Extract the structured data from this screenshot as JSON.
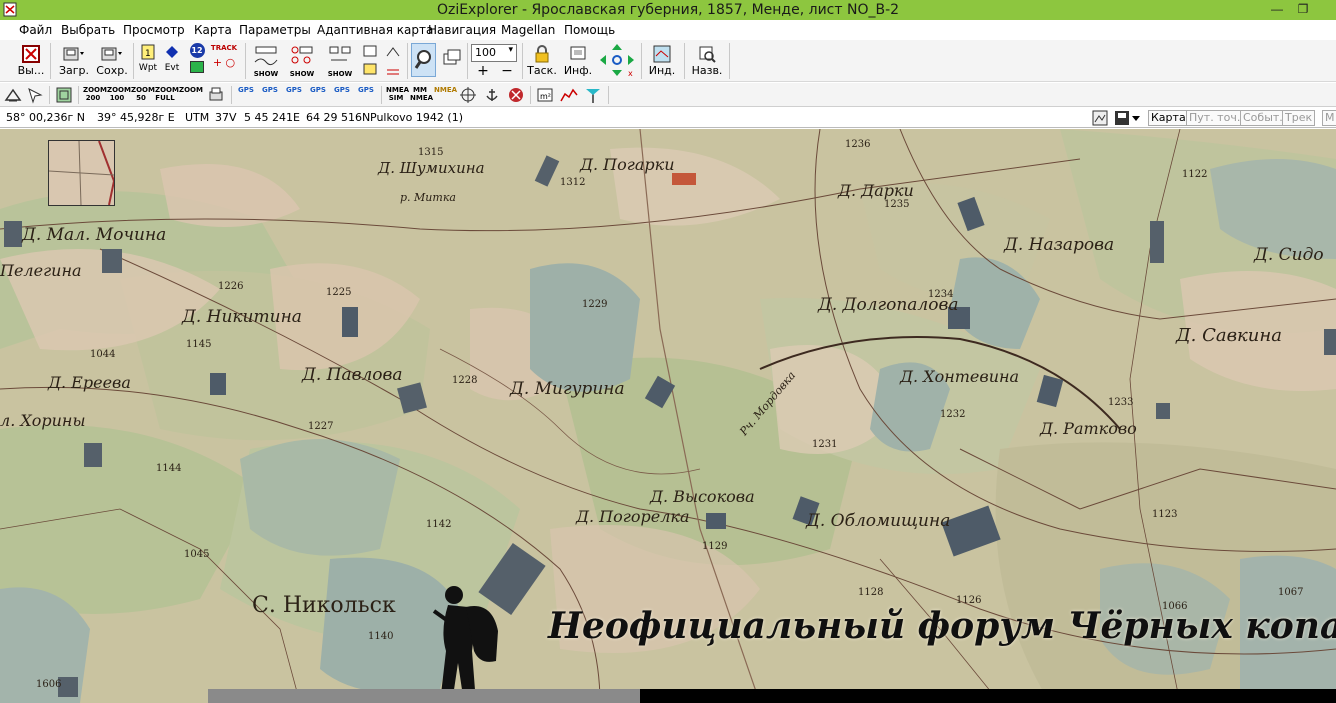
{
  "window": {
    "title": "OziExplorer - Ярославская губерния, 1857, Менде, лист NO_B-2",
    "minimize_glyph": "—",
    "maximize_glyph": "❐"
  },
  "menu": [
    "Файл",
    "Выбрать",
    "Просмотр",
    "Карта",
    "Параметры",
    "Адаптивная карта",
    "Навигация",
    "Magellan",
    "Помощь"
  ],
  "toolbar": {
    "exit_label": "Вы...",
    "load_label": "Загр.",
    "save_label": "Сохр.",
    "wpt_label": "Wpt",
    "evt_label": "Evt",
    "evt_badge": "12",
    "track_label": "TRACK",
    "show_label": "SHOW",
    "zoom_value": "100",
    "task_label": "Таск.",
    "info_label": "Инф.",
    "ind_label": "Инд.",
    "name_label": "Назв."
  },
  "toolbar2": {
    "zoom_buttons": [
      "ZOOM 200",
      "ZOOM 100",
      "ZOOM 50",
      "ZOOM FULL",
      "ZOOM"
    ],
    "gps_buttons": [
      "GPS",
      "GPS",
      "GPS",
      "GPS",
      "GPS",
      "GPS"
    ],
    "nmea_sim": "NMEA SIM",
    "mm_nmea": "MM NMEA",
    "nmea": "NMEA"
  },
  "status": {
    "lat": "58° 00,236г N",
    "lon": "39° 45,928г E",
    "utm_label": "UTM",
    "utm_zone": "37V",
    "easting": "5 45 241E",
    "northing": "64 29 516N",
    "datum": "Pulkovo 1942 (1)",
    "tabs": [
      "Карта",
      "Пут. точ.",
      "Событ.",
      "Трек",
      "М"
    ]
  },
  "map": {
    "places": [
      {
        "label": "Д. Погарки"
      },
      {
        "label": "Д. Шумихина"
      },
      {
        "label": "Д. Дарки"
      },
      {
        "label": "Д. Назарова"
      },
      {
        "label": "Д. Сидо"
      },
      {
        "label": "Д. Мал. Мочина"
      },
      {
        "label": "Пелегина"
      },
      {
        "label": "Д. Никитина"
      },
      {
        "label": "Д. Долгопалова"
      },
      {
        "label": "Д. Савкина"
      },
      {
        "label": "Д. Ереева"
      },
      {
        "label": "Д. Павлова"
      },
      {
        "label": "Д. Мигурина"
      },
      {
        "label": "Д. Хонтевина"
      },
      {
        "label": "л. Хорины"
      },
      {
        "label": "Д. Ратково"
      },
      {
        "label": "Д. Высокова"
      },
      {
        "label": "Д. Погорелка"
      },
      {
        "label": "Д. Обломищина"
      },
      {
        "label": "С. Никольск"
      },
      {
        "label": "р. Митка"
      },
      {
        "label": "Рч. Мордовка"
      }
    ],
    "numbers": [
      "1315",
      "1312",
      "1236",
      "1235",
      "1122",
      "1225",
      "1229",
      "1234",
      "1226",
      "1145",
      "1044",
      "1228",
      "1232",
      "1233",
      "1227",
      "1231",
      "1144",
      "1045",
      "1142",
      "1129",
      "1123",
      "1128",
      "1126",
      "1066",
      "1067",
      "1140",
      "1606"
    ],
    "watermark": "Неофициальный форум Чёрных копателей"
  }
}
